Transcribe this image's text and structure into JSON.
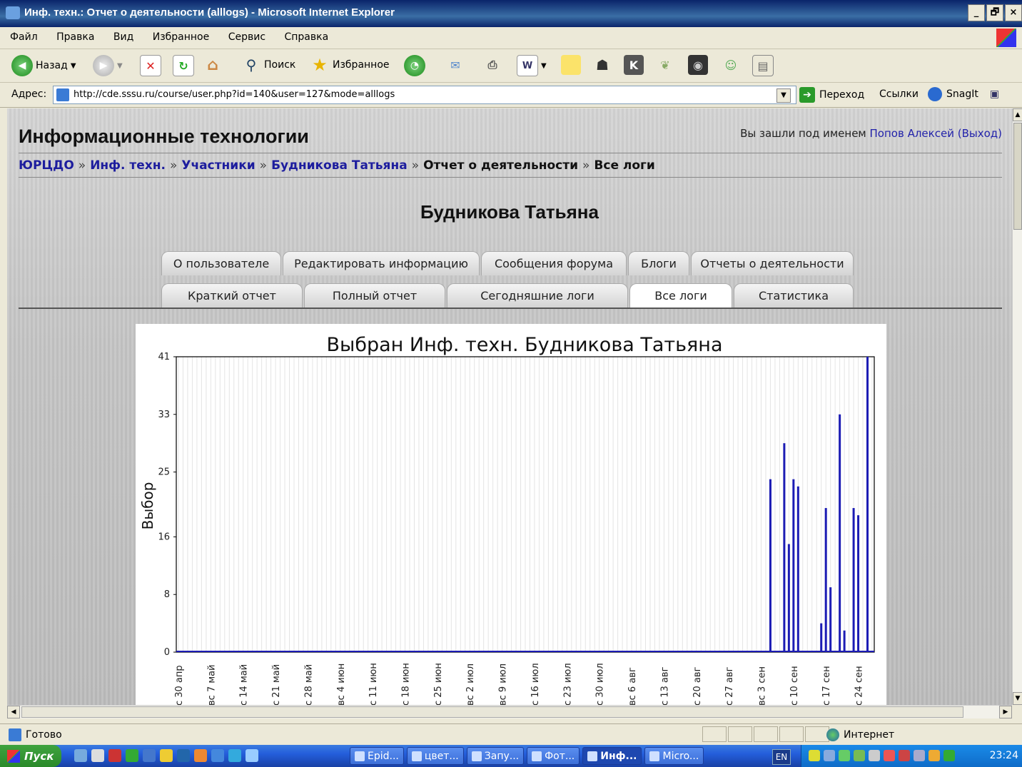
{
  "window": {
    "title": "Инф. техн.: Отчет о деятельности (alllogs) - Microsoft Internet Explorer",
    "min": "_",
    "max": "🗗",
    "close": "×"
  },
  "menu": [
    "Файл",
    "Правка",
    "Вид",
    "Избранное",
    "Сервис",
    "Справка"
  ],
  "toolbar": {
    "back": "Назад",
    "search": "Поиск",
    "favorites": "Избранное"
  },
  "address": {
    "label": "Адрес:",
    "url": "http://cde.sssu.ru/course/user.php?id=140&user=127&mode=alllogs",
    "go": "Переход",
    "links": "Ссылки",
    "snagit": "SnagIt"
  },
  "site": {
    "title": "Информационные технологии",
    "login_prefix": "Вы зашли под именем",
    "login_user": "Попов Алексей",
    "logout": "(Выход)"
  },
  "breadcrumb": {
    "home": "ЮРЦДО",
    "course": "Инф. техн.",
    "participants": "Участники",
    "user": "Будникова Татьяна",
    "report": "Отчет о деятельности",
    "current": "Все логи",
    "sep": "»"
  },
  "user_name": "Будникова Татьяна",
  "tabs_row1": [
    "О пользователе",
    "Редактировать информацию",
    "Сообщения форума",
    "Блоги",
    "Отчеты о деятельности"
  ],
  "tabs_row2": [
    "Краткий отчет",
    "Полный отчет",
    "Сегодняшние логи",
    "Все логи",
    "Статистика"
  ],
  "active_tab_row2": 3,
  "chart_data": {
    "type": "bar",
    "title": "Выбран Инф. техн. Будникова Татьяна",
    "ylabel": "Выбор",
    "ylim": [
      0,
      41
    ],
    "yticks": [
      0,
      8,
      16,
      25,
      33,
      41
    ],
    "xtick_labels": [
      "с 30 апр",
      "вс 7 май",
      "с 14 май",
      "с 21 май",
      "с 28 май",
      "вс 4 июн",
      "с 11 июн",
      "с 18 июн",
      "с 25 июн",
      "вс 2 июл",
      "вс 9 июл",
      "с 16 июл",
      "с 23 июл",
      "с 30 июл",
      "вс 6 авг",
      "с 13 авг",
      "с 20 авг",
      "с 27 авг",
      "вс 3 сен",
      "с 10 сен",
      "с 17 сен",
      "с 24 сен"
    ],
    "x_start_days": 0,
    "bars": [
      {
        "x": "с 3 сен (+2)",
        "day": 128,
        "value": 24
      },
      {
        "x": "с 10 сен (-1)",
        "day": 131,
        "value": 29
      },
      {
        "x": "с 10 сен",
        "day": 132,
        "value": 15
      },
      {
        "x": "с 10 сен (+1)",
        "day": 133,
        "value": 24
      },
      {
        "x": "с 10 сен (+2)",
        "day": 134,
        "value": 23
      },
      {
        "x": "с 17 сен",
        "day": 139,
        "value": 4
      },
      {
        "x": "с 17 сен (+1)",
        "day": 140,
        "value": 20
      },
      {
        "x": "с 17 сен (+2)",
        "day": 141,
        "value": 9
      },
      {
        "x": "с 24 сен (-2)",
        "day": 143,
        "value": 33
      },
      {
        "x": "с 24 сен (-1)",
        "day": 144,
        "value": 3
      },
      {
        "x": "с 24 сен (+1)",
        "day": 146,
        "value": 20
      },
      {
        "x": "с 24 сен (+2)",
        "day": 147,
        "value": 19
      },
      {
        "x": "с 24 сен (+4)",
        "day": 149,
        "value": 41
      }
    ],
    "bar_color": "#1c1cb4",
    "grid": true
  },
  "statusbar": {
    "status": "Готово",
    "zone": "Интернет"
  },
  "taskbar": {
    "start": "Пуск",
    "tasks": [
      "Epid...",
      "цвет...",
      "Запу...",
      "Фот...",
      "Инф...",
      "Micro..."
    ],
    "lang": "EN",
    "clock": "23:24"
  }
}
